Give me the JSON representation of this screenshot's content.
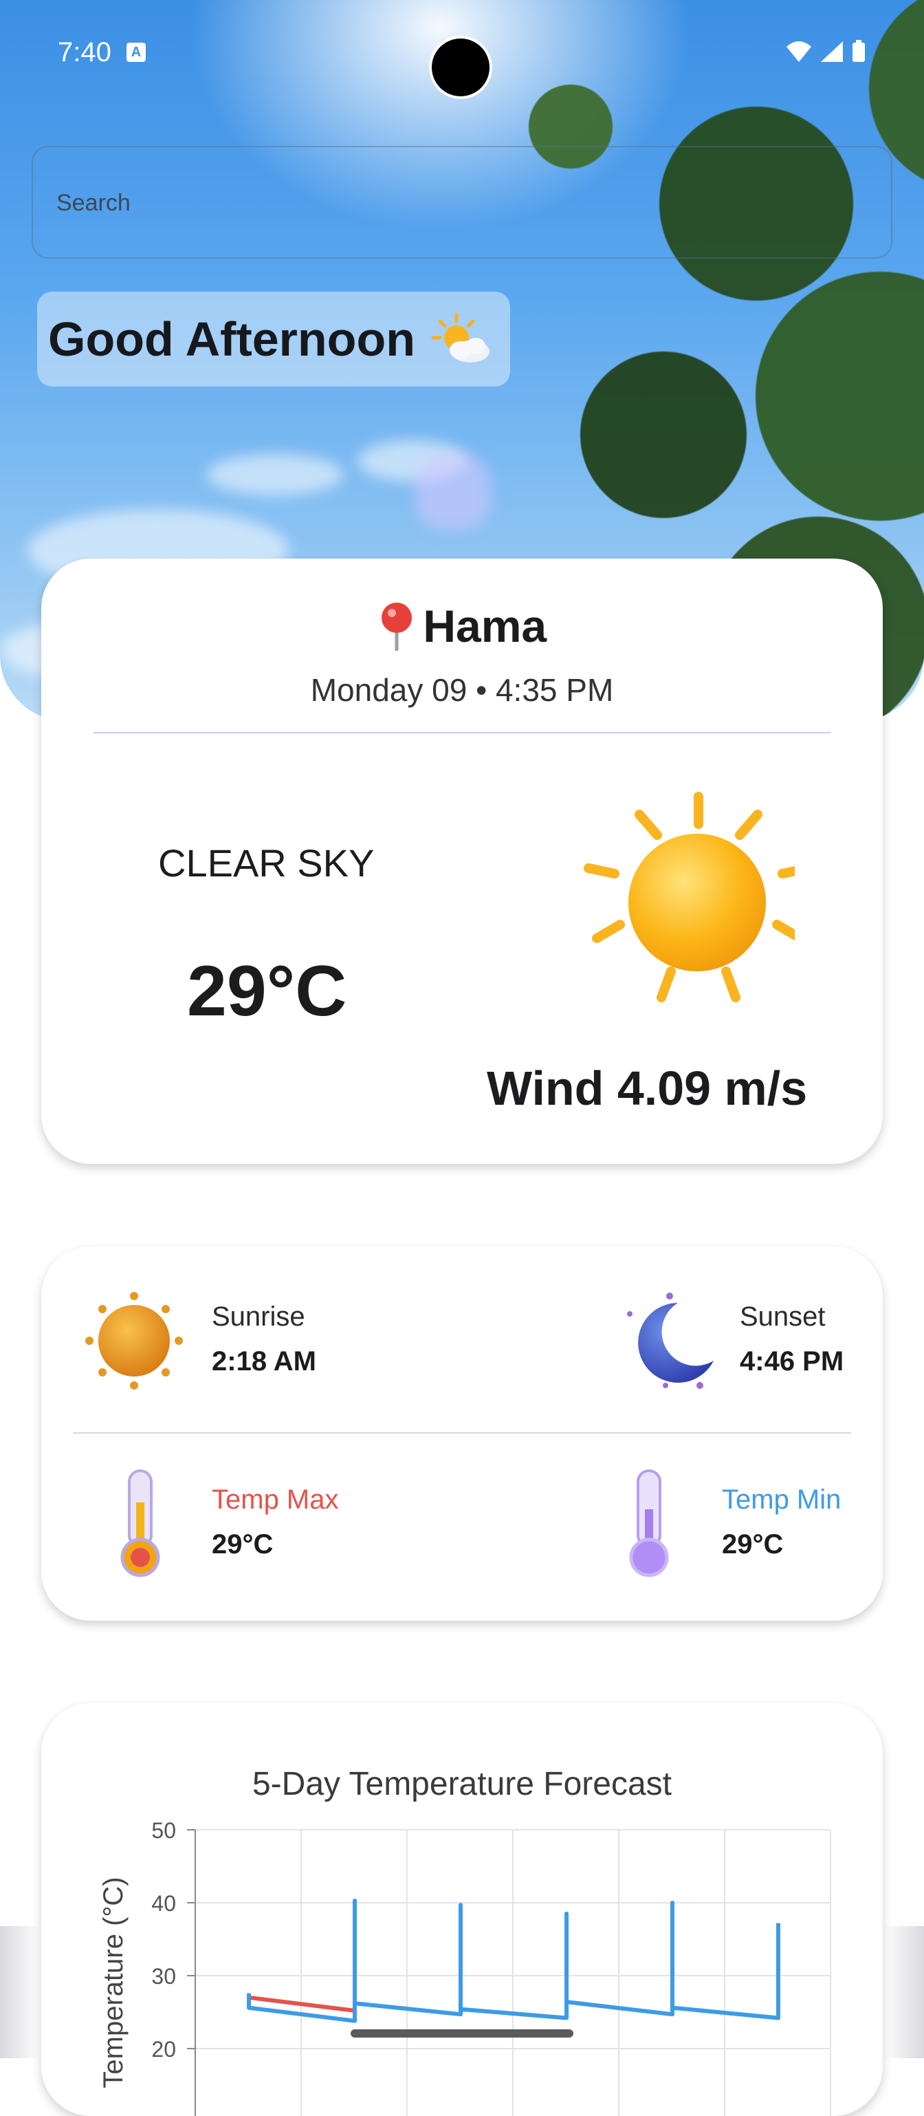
{
  "status_bar": {
    "time": "7:40",
    "notification_icon": "font-accessibility-icon"
  },
  "search": {
    "placeholder": "Search",
    "value": ""
  },
  "greeting": {
    "text": "Good Afternoon",
    "icon": "sun-behind-cloud-icon"
  },
  "weather": {
    "city": "Hama",
    "datetime": "Monday 09 • 4:35 PM",
    "condition": "CLEAR SKY",
    "temperature": "29°C",
    "wind": "Wind 4.09 m/s"
  },
  "astro": {
    "sunrise_label": "Sunrise",
    "sunrise_value": "2:18 AM",
    "sunset_label": "Sunset",
    "sunset_value": "4:46 PM",
    "temp_max_label": "Temp Max",
    "temp_max_value": "29°C",
    "temp_min_label": "Temp Min",
    "temp_min_value": "29°C"
  },
  "colors": {
    "temp_max": "#e5524a",
    "temp_min": "#3d9be6",
    "accent_sky": "#3b8fe4",
    "sun": "#f9b31b"
  },
  "chart_data": {
    "type": "line",
    "title": "5-Day Temperature Forecast",
    "ylabel": "Temperature (°C)",
    "ylim": [
      20,
      50
    ],
    "yticks": [
      20,
      30,
      40,
      50
    ],
    "grid": true,
    "series": [
      {
        "color": "#e5524a",
        "points": [
          [
            0,
            27
          ],
          [
            1,
            25.2
          ]
        ]
      },
      {
        "color": "#3d9be6",
        "points": [
          [
            0,
            27.6
          ],
          [
            0,
            25.6
          ],
          [
            1,
            23.8
          ],
          [
            1,
            40.3
          ],
          [
            1,
            26.2
          ],
          [
            2,
            24.7
          ],
          [
            2,
            39.7
          ],
          [
            2,
            25.4
          ],
          [
            3,
            24.2
          ],
          [
            3,
            38.5
          ],
          [
            3,
            26.4
          ],
          [
            4,
            24.7
          ],
          [
            4,
            40
          ],
          [
            4,
            25.6
          ],
          [
            5,
            24.2
          ],
          [
            5,
            37.2
          ]
        ]
      }
    ]
  }
}
